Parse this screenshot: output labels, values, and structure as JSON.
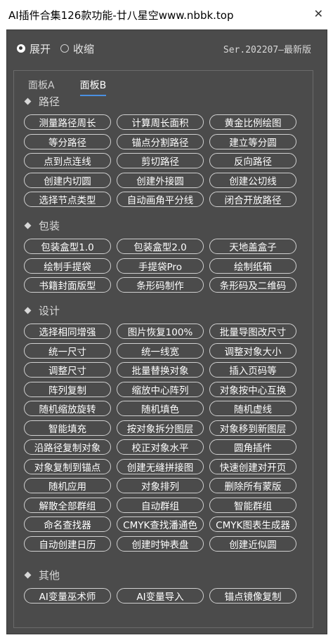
{
  "window": {
    "title": "AI插件合集126款功能-廿八星空www.nbbk.top",
    "close_label": "✕"
  },
  "options": {
    "expand_label": "展开",
    "collapse_label": "收缩",
    "selected": "expand"
  },
  "version": "Ser.202207—最新版",
  "tabs": [
    {
      "label": "面板A"
    },
    {
      "label": "面板B"
    }
  ],
  "active_tab": "面板B",
  "sections": [
    {
      "title": "路径",
      "buttons": [
        "测量路径周长",
        "计算周长面积",
        "黄金比例绘图",
        "等分路径",
        "锚点分割路径",
        "建立等分圆",
        "点到点连线",
        "剪切路径",
        "反向路径",
        "创建内切圆",
        "创建外接圆",
        "创建公切线",
        "选择节点类型",
        "自动画角平分线",
        "闭合开放路径"
      ]
    },
    {
      "title": "包装",
      "buttons": [
        "包装盒型1.0",
        "包装盒型2.0",
        "天地盖盒子",
        "绘制手提袋",
        "手提袋Pro",
        "绘制纸箱",
        "书籍封面版型",
        "条形码制作",
        "条形码及二维码"
      ]
    },
    {
      "title": "设计",
      "buttons": [
        "选择相同增强",
        "图片恢复100%",
        "批量导图改尺寸",
        "统一尺寸",
        "统一线宽",
        "调整对象大小",
        "调整尺寸",
        "批量替换对象",
        "插入页码等",
        "阵列复制",
        "缩放中心阵列",
        "对象按中心互换",
        "随机缩放旋转",
        "随机填色",
        "随机虚线",
        "智能填充",
        "按对象拆分图层",
        "对象移到新图层",
        "沿路径复制对象",
        "校正对象水平",
        "圆角插件",
        "对象复制到锚点",
        "创建无缝拼接图",
        "快速创建对开页",
        "随机应用",
        "对象排列",
        "删除所有蒙版",
        "解散全部群组",
        "自动群组",
        "智能群组",
        "命名查找器",
        "CMYK查找潘通色",
        "CMYK图表生成器",
        "自动创建日历",
        "创建时钟表盘",
        "创建近似圆"
      ]
    },
    {
      "title": "其他",
      "buttons": [
        "AI变量巫术师",
        "AI变量导入",
        "锚点镜像复制"
      ]
    }
  ]
}
